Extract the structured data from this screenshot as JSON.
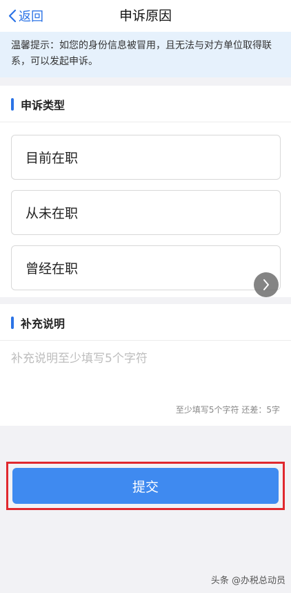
{
  "nav": {
    "back_label": "返回",
    "title": "申诉原因"
  },
  "notice": {
    "text": "温馨提示：如您的身份信息被冒用，且无法与对方单位取得联系，可以发起申诉。"
  },
  "type_section": {
    "title": "申诉类型",
    "options": [
      "目前在职",
      "从未在职",
      "曾经在职"
    ]
  },
  "note_section": {
    "title": "补充说明",
    "placeholder": "补充说明至少填写5个字符",
    "counter": "至少填写5个字符 还差：5字"
  },
  "submit": {
    "label": "提交"
  },
  "floating_button": {
    "icon": "chevron-right-icon"
  },
  "watermark": "头条 @办税总动员",
  "colors": {
    "accent": "#2b73e6",
    "button": "#3f8af0",
    "highlight_border": "#e0282e",
    "notice_bg": "#e6f1fc"
  }
}
